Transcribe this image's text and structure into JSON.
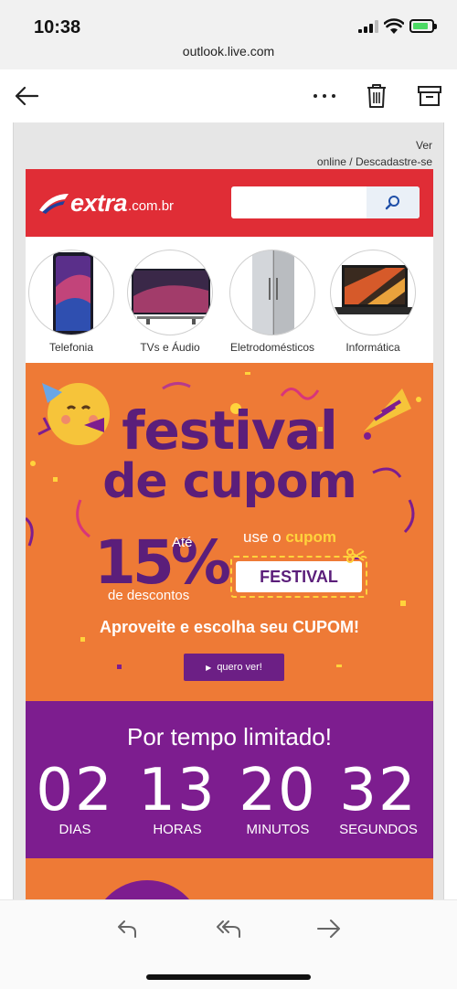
{
  "status_bar": {
    "time": "10:38",
    "url": "outlook.live.com"
  },
  "toolbar": {
    "back_icon": "arrow-left-icon",
    "more_icon": "more-dots-icon",
    "delete_icon": "trash-icon",
    "archive_icon": "archive-icon"
  },
  "email": {
    "links": {
      "line1": "Ver",
      "line2": "online / Descadastre-se"
    },
    "header": {
      "logo_word": "extra",
      "logo_domain": ".com.br",
      "search_placeholder": "",
      "search_icon": "search-icon"
    },
    "categories": [
      {
        "label": "Telefonia"
      },
      {
        "label": "TVs e Áudio"
      },
      {
        "label": "Eletrodomésticos"
      },
      {
        "label": "Informática"
      }
    ],
    "promo": {
      "title_line1": "festival",
      "title_line2": "de cupom",
      "percent": "15%",
      "ate": "Até",
      "descontos": "de descontos",
      "use_prefix": "use o",
      "use_cupom": "cupom",
      "coupon_code": "FESTIVAL",
      "aproveite": "Aproveite e escolha seu CUPOM!",
      "button": "quero ver!"
    },
    "timer": {
      "title": "Por tempo limitado!",
      "units": [
        {
          "value": "02",
          "label": "DIAS"
        },
        {
          "value": "13",
          "label": "HORAS"
        },
        {
          "value": "20",
          "label": "MINUTOS"
        },
        {
          "value": "32",
          "label": "SEGUNDOS"
        }
      ]
    }
  },
  "bottom_bar": {
    "reply_icon": "reply-icon",
    "reply_all_icon": "reply-all-icon",
    "forward_icon": "forward-icon"
  },
  "colors": {
    "brand_red": "#e02d36",
    "promo_orange": "#ee7a36",
    "purple": "#7d1d8f",
    "title_purple": "#5b1e7a",
    "coupon_yellow": "#ffd33c"
  }
}
